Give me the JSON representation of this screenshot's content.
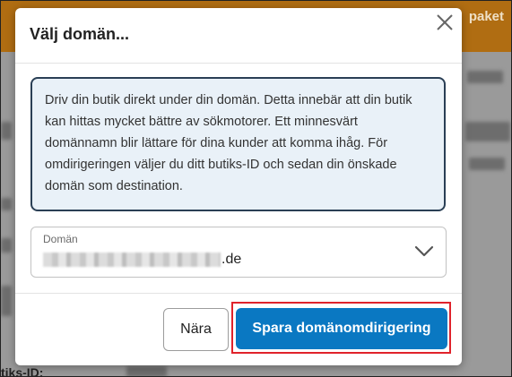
{
  "background": {
    "topbar_text": "paket",
    "bottom_text": "tiks-ID:",
    "topbar_color": "#b06d12"
  },
  "modal": {
    "title": "Välj domän...",
    "close_icon": "close-icon",
    "info_text": "Driv din butik direkt under din domän. Detta innebär att din butik kan hittas mycket bättre av sökmotorer. Ett minnesvärt domännamn blir lättare för dina kunder att komma ihåg. För omdirigeringen väljer du ditt butiks-ID och sedan din önskade domän som destination.",
    "domain_field": {
      "label": "Domän",
      "value_suffix": ".de",
      "icon": "chevron-down-icon"
    },
    "buttons": {
      "close_label": "Nära",
      "save_label": "Spara domänomdirigering"
    },
    "colors": {
      "primary": "#0a78c2",
      "info_bg": "#e9f1f8",
      "info_border": "#2a3f55",
      "highlight": "#e0222b"
    }
  }
}
